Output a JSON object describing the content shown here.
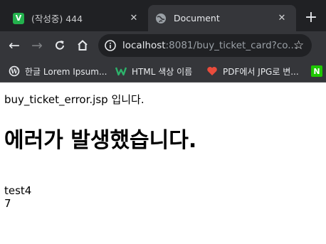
{
  "tabs": [
    {
      "title": "(작성중) 444",
      "favicon_letter": "V"
    },
    {
      "title": "Document"
    }
  ],
  "address": {
    "host": "localhost",
    "path": ":8081/buy_ticket_card?co..."
  },
  "bookmarks": [
    {
      "label": "한글 Lorem Ipsum..."
    },
    {
      "label": "HTML 색상 이름"
    },
    {
      "label": "PDF에서 JPG로 변..."
    },
    {
      "label": "N"
    }
  ],
  "page": {
    "intro": "buy_ticket_error.jsp 입니다.",
    "heading": "에러가 발생했습니다.",
    "line1": "test4",
    "line2": "7"
  },
  "colors": {
    "frame": "#202124",
    "toolbar": "#35363a",
    "accent_green": "#23b14d"
  }
}
